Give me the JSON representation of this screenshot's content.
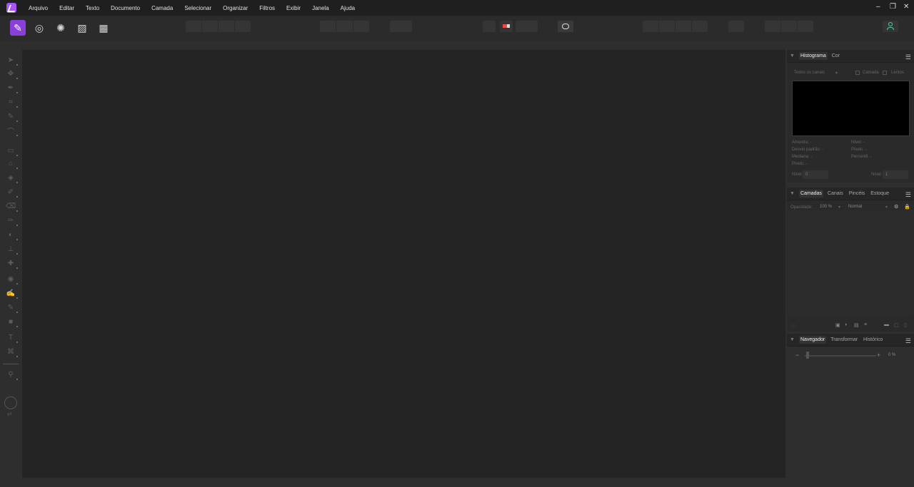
{
  "menu": {
    "items": [
      "Arquivo",
      "Editar",
      "Texto",
      "Documento",
      "Camada",
      "Selecionar",
      "Organizar",
      "Filtros",
      "Exibir",
      "Janela",
      "Ajuda"
    ]
  },
  "window_controls": {
    "minimize": "–",
    "restore": "❐",
    "close": "✕"
  },
  "personas": [
    {
      "icon": "photo-persona-icon",
      "glyph": "✎",
      "active": true
    },
    {
      "icon": "liquify-persona-icon",
      "glyph": "◎",
      "active": false
    },
    {
      "icon": "develop-persona-icon",
      "glyph": "✺",
      "active": false
    },
    {
      "icon": "tone-mapping-persona-icon",
      "glyph": "▨",
      "active": false
    },
    {
      "icon": "export-persona-icon",
      "glyph": "▦",
      "active": false
    }
  ],
  "histogram_panel": {
    "tabs": [
      "Histograma",
      "Cor"
    ],
    "channel_select": "Todos os canais",
    "option1": "Camada",
    "option2": "Lentos",
    "stats_left": [
      "Amostra: -",
      "Desvio padrão: -",
      "Mediana: -",
      "Pixels: -"
    ],
    "stats_right": [
      "Nível: -",
      "Pixels: -",
      "Percentil: -"
    ],
    "bottom_left_label": "Nível",
    "bottom_left_value": "0",
    "bottom_right_label": "Nível",
    "bottom_right_value": "1"
  },
  "layers_panel": {
    "tabs": [
      "Camadas",
      "Canais",
      "Pincéis",
      "Estoque"
    ],
    "opacity_label": "Opacidade:",
    "opacity_value": "100 %",
    "blend_mode": "Normal"
  },
  "navigator_panel": {
    "tabs": [
      "Navegador",
      "Transformar",
      "Histórico"
    ],
    "zoom_minus": "−",
    "zoom_plus": "+",
    "zoom_value": "0 %"
  }
}
